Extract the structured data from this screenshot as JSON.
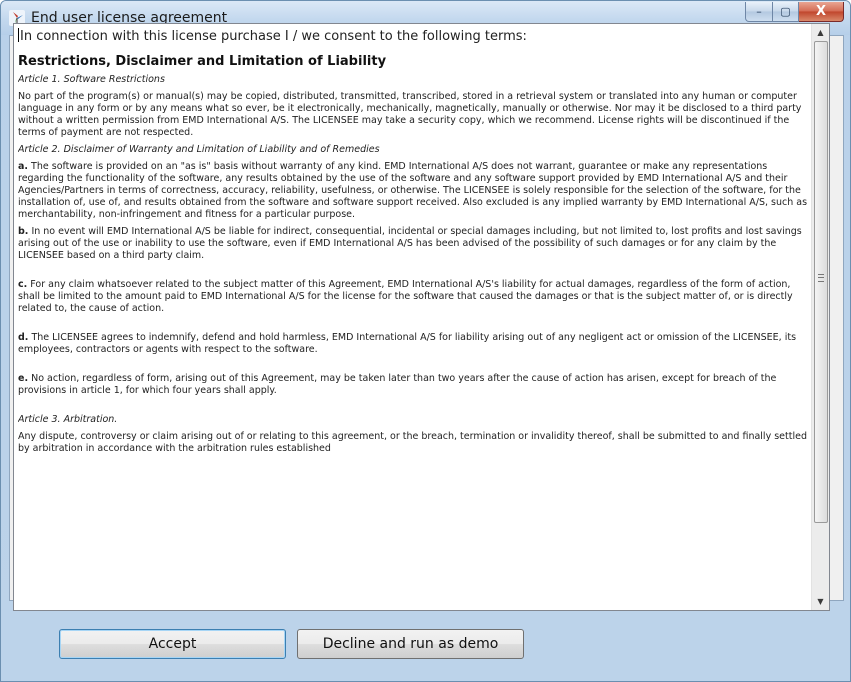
{
  "window": {
    "title": "End user license agreement",
    "app_icon": "wind-turbine-icon",
    "caption": {
      "minimize": "–",
      "maximize": "▢",
      "close": "X"
    }
  },
  "license": {
    "intro": "In connection with this license purchase I / we consent to the following terms:",
    "heading": "Restrictions, Disclaimer and Limitation of Liability",
    "article1_title": "Article 1.  Software Restrictions",
    "article1_text": "No part of the program(s) or manual(s) may be copied, distributed, transmitted, transcribed, stored in a retrieval system or translated into any human or computer language in any form or by any means what so ever, be it electronically, mechanically, magnetically, manually or otherwise. Nor may it be disclosed to a third party without a written permission from EMD International A/S. The LICENSEE may take a security copy, which we recommend. License rights will be discontinued if the terms of payment are not respected.",
    "article2_title": "Article 2.  Disclaimer of Warranty and Limitation of Liability and of Remedies",
    "para_a_label": "a.",
    "para_a": " The software is provided on an \"as is\" basis without warranty of any kind. EMD International A/S does not warrant, guarantee or make any representations regarding the functionality of the software, any results obtained by the use of the software and any software support provided by EMD International A/S and their Agencies/Partners in terms of correctness, accuracy, reliability, usefulness, or otherwise. The LICENSEE is solely responsible for the selection of the software, for the installation of, use of, and results obtained from the software and software support received.  Also excluded is any implied warranty by EMD International A/S, such as merchantability, non-infringement and fitness for a particular purpose.",
    "para_b_label": "b.",
    "para_b": " In no event will EMD International A/S be liable for indirect, consequential, incidental or special damages including, but not limited to, lost profits and lost savings arising out of the use or inability to use the software, even if EMD International A/S has been advised of the possibility of such damages or for any claim by the LICENSEE based on a third party claim.",
    "para_c_label": "c.",
    "para_c": " For any claim whatsoever related to the subject matter of this Agreement, EMD International A/S's liability for actual damages, regardless of the form of action, shall be limited to the amount paid to EMD International A/S for the license for the software that caused the damages or that is the subject matter of, or is directly related to, the cause of action.",
    "para_d_label": "d.",
    "para_d": " The LICENSEE agrees to indemnify, defend and hold harmless, EMD International A/S for liability arising out of any negligent act or omission of the LICENSEE, its employees, contractors or agents with respect to the software.",
    "para_e_label": "e.",
    "para_e": " No action, regardless of form, arising out of this Agreement, may be taken later than two years after the cause of action has arisen, except for breach of the provisions in article 1, for which four years shall apply.",
    "article3_title": "Article 3. Arbitration.",
    "article3_text": "Any dispute, controversy or claim arising out of or relating to this agreement, or the breach, termination or invalidity thereof, shall be submitted to and finally settled by arbitration in accordance with the arbitration rules established"
  },
  "scrollbar": {
    "up_arrow": "▲",
    "down_arrow": "▼"
  },
  "buttons": {
    "accept": "Accept",
    "decline": "Decline and run as demo"
  },
  "colors": {
    "title_gradient_top": "#dbe8f6",
    "close_button": "#c0452c",
    "default_button_border": "#3c7fb1"
  }
}
